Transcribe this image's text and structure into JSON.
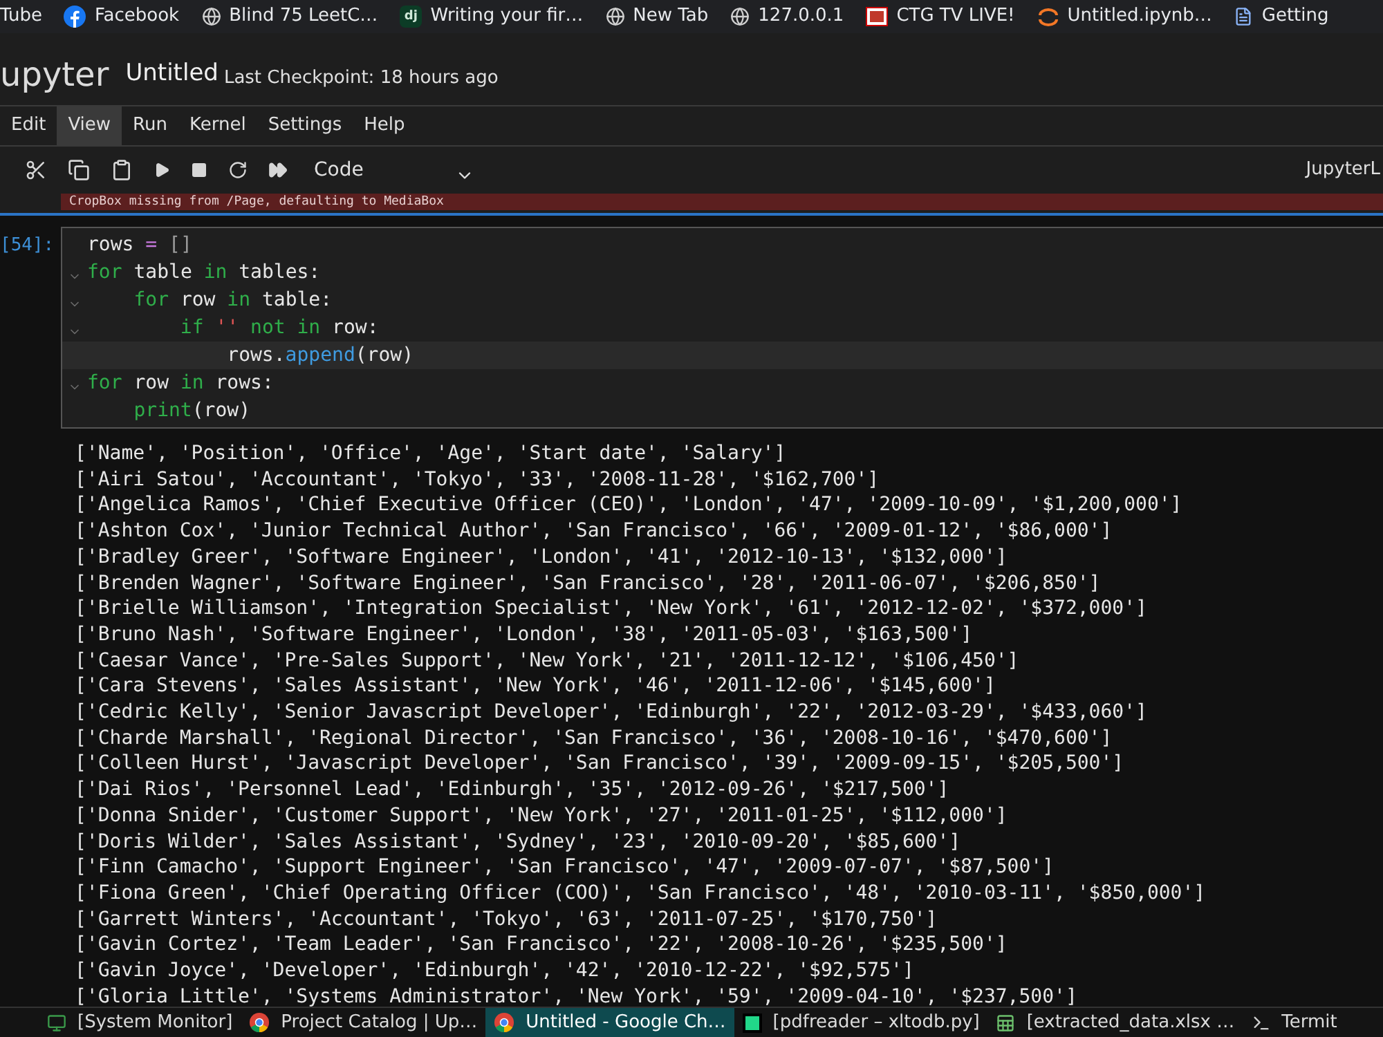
{
  "bookmarks": [
    {
      "label": "Tube"
    },
    {
      "label": "Facebook"
    },
    {
      "label": "Blind 75 LeetC…"
    },
    {
      "label": "Writing your fir…",
      "icon_text": "dj"
    },
    {
      "label": "New Tab"
    },
    {
      "label": "127.0.0.1"
    },
    {
      "label": "CTG TV LIVE!"
    },
    {
      "label": "Untitled.ipynb…"
    },
    {
      "label": "Getting"
    }
  ],
  "header": {
    "logo": "upyter",
    "title": "Untitled",
    "checkpoint": "Last Checkpoint: 18 hours ago"
  },
  "menu": [
    {
      "label": "Edit",
      "selected": false
    },
    {
      "label": "View",
      "selected": true
    },
    {
      "label": "Run",
      "selected": false
    },
    {
      "label": "Kernel",
      "selected": false
    },
    {
      "label": "Settings",
      "selected": false
    },
    {
      "label": "Help",
      "selected": false
    }
  ],
  "toolbar": {
    "cell_type": "Code",
    "kernel": "JupyterL"
  },
  "error_output": "CropBox missing from /Page, defaulting to MediaBox",
  "cell": {
    "prompt": "[54]:",
    "lines": [
      {
        "fold": false,
        "current": false,
        "tokens": [
          {
            "t": "rows ",
            "kind": "name"
          },
          {
            "t": "=",
            "kind": "op"
          },
          {
            "t": " []",
            "kind": "bracket"
          }
        ]
      },
      {
        "fold": true,
        "current": false,
        "tokens": [
          {
            "t": "for",
            "kind": "kw"
          },
          {
            "t": " table ",
            "kind": "name"
          },
          {
            "t": "in",
            "kind": "kw"
          },
          {
            "t": " tables:",
            "kind": "name"
          }
        ]
      },
      {
        "fold": true,
        "current": false,
        "tokens": [
          {
            "t": "    for",
            "kind": "kw"
          },
          {
            "t": " row ",
            "kind": "name"
          },
          {
            "t": "in",
            "kind": "kw"
          },
          {
            "t": " table:",
            "kind": "name"
          }
        ]
      },
      {
        "fold": true,
        "current": false,
        "tokens": [
          {
            "t": "        if",
            "kind": "kw"
          },
          {
            "t": " ''",
            "kind": "str"
          },
          {
            "t": " not in",
            "kind": "kw"
          },
          {
            "t": " row:",
            "kind": "name"
          }
        ]
      },
      {
        "fold": false,
        "current": true,
        "tokens": [
          {
            "t": "            rows.",
            "kind": "name"
          },
          {
            "t": "append",
            "kind": "func"
          },
          {
            "t": "(row)",
            "kind": "name"
          }
        ]
      },
      {
        "fold": true,
        "current": false,
        "tokens": [
          {
            "t": "for",
            "kind": "kw"
          },
          {
            "t": " row ",
            "kind": "name"
          },
          {
            "t": "in",
            "kind": "kw"
          },
          {
            "t": " rows:",
            "kind": "name"
          }
        ]
      },
      {
        "fold": false,
        "current": false,
        "tokens": [
          {
            "t": "    print",
            "kind": "builtin"
          },
          {
            "t": "(row)",
            "kind": "name"
          }
        ]
      }
    ]
  },
  "output": [
    "['Name', 'Position', 'Office', 'Age', 'Start date', 'Salary']",
    "['Airi Satou', 'Accountant', 'Tokyo', '33', '2008-11-28', '$162,700']",
    "['Angelica Ramos', 'Chief Executive Officer (CEO)', 'London', '47', '2009-10-09', '$1,200,000']",
    "['Ashton Cox', 'Junior Technical Author', 'San Francisco', '66', '2009-01-12', '$86,000']",
    "['Bradley Greer', 'Software Engineer', 'London', '41', '2012-10-13', '$132,000']",
    "['Brenden Wagner', 'Software Engineer', 'San Francisco', '28', '2011-06-07', '$206,850']",
    "['Brielle Williamson', 'Integration Specialist', 'New York', '61', '2012-12-02', '$372,000']",
    "['Bruno Nash', 'Software Engineer', 'London', '38', '2011-05-03', '$163,500']",
    "['Caesar Vance', 'Pre-Sales Support', 'New York', '21', '2011-12-12', '$106,450']",
    "['Cara Stevens', 'Sales Assistant', 'New York', '46', '2011-12-06', '$145,600']",
    "['Cedric Kelly', 'Senior Javascript Developer', 'Edinburgh', '22', '2012-03-29', '$433,060']",
    "['Charde Marshall', 'Regional Director', 'San Francisco', '36', '2008-10-16', '$470,600']",
    "['Colleen Hurst', 'Javascript Developer', 'San Francisco', '39', '2009-09-15', '$205,500']",
    "['Dai Rios', 'Personnel Lead', 'Edinburgh', '35', '2012-09-26', '$217,500']",
    "['Donna Snider', 'Customer Support', 'New York', '27', '2011-01-25', '$112,000']",
    "['Doris Wilder', 'Sales Assistant', 'Sydney', '23', '2010-09-20', '$85,600']",
    "['Finn Camacho', 'Support Engineer', 'San Francisco', '47', '2009-07-07', '$87,500']",
    "['Fiona Green', 'Chief Operating Officer (COO)', 'San Francisco', '48', '2010-03-11', '$850,000']",
    "['Garrett Winters', 'Accountant', 'Tokyo', '63', '2011-07-25', '$170,750']",
    "['Gavin Cortez', 'Team Leader', 'San Francisco', '22', '2008-10-26', '$235,500']",
    "['Gavin Joyce', 'Developer', 'Edinburgh', '42', '2010-12-22', '$92,575']",
    "['Gloria Little', 'Systems Administrator', 'New York', '59', '2009-04-10', '$237,500']"
  ],
  "taskbar": [
    {
      "label": "[System Monitor]",
      "selected": false
    },
    {
      "label": "Project Catalog | Up…",
      "selected": false
    },
    {
      "label": "Untitled - Google Ch…",
      "selected": true
    },
    {
      "label": "[pdfreader – xltodb.py]",
      "selected": false
    },
    {
      "label": "[extracted_data.xlsx …",
      "selected": false
    },
    {
      "label": "Termit",
      "selected": false
    }
  ]
}
